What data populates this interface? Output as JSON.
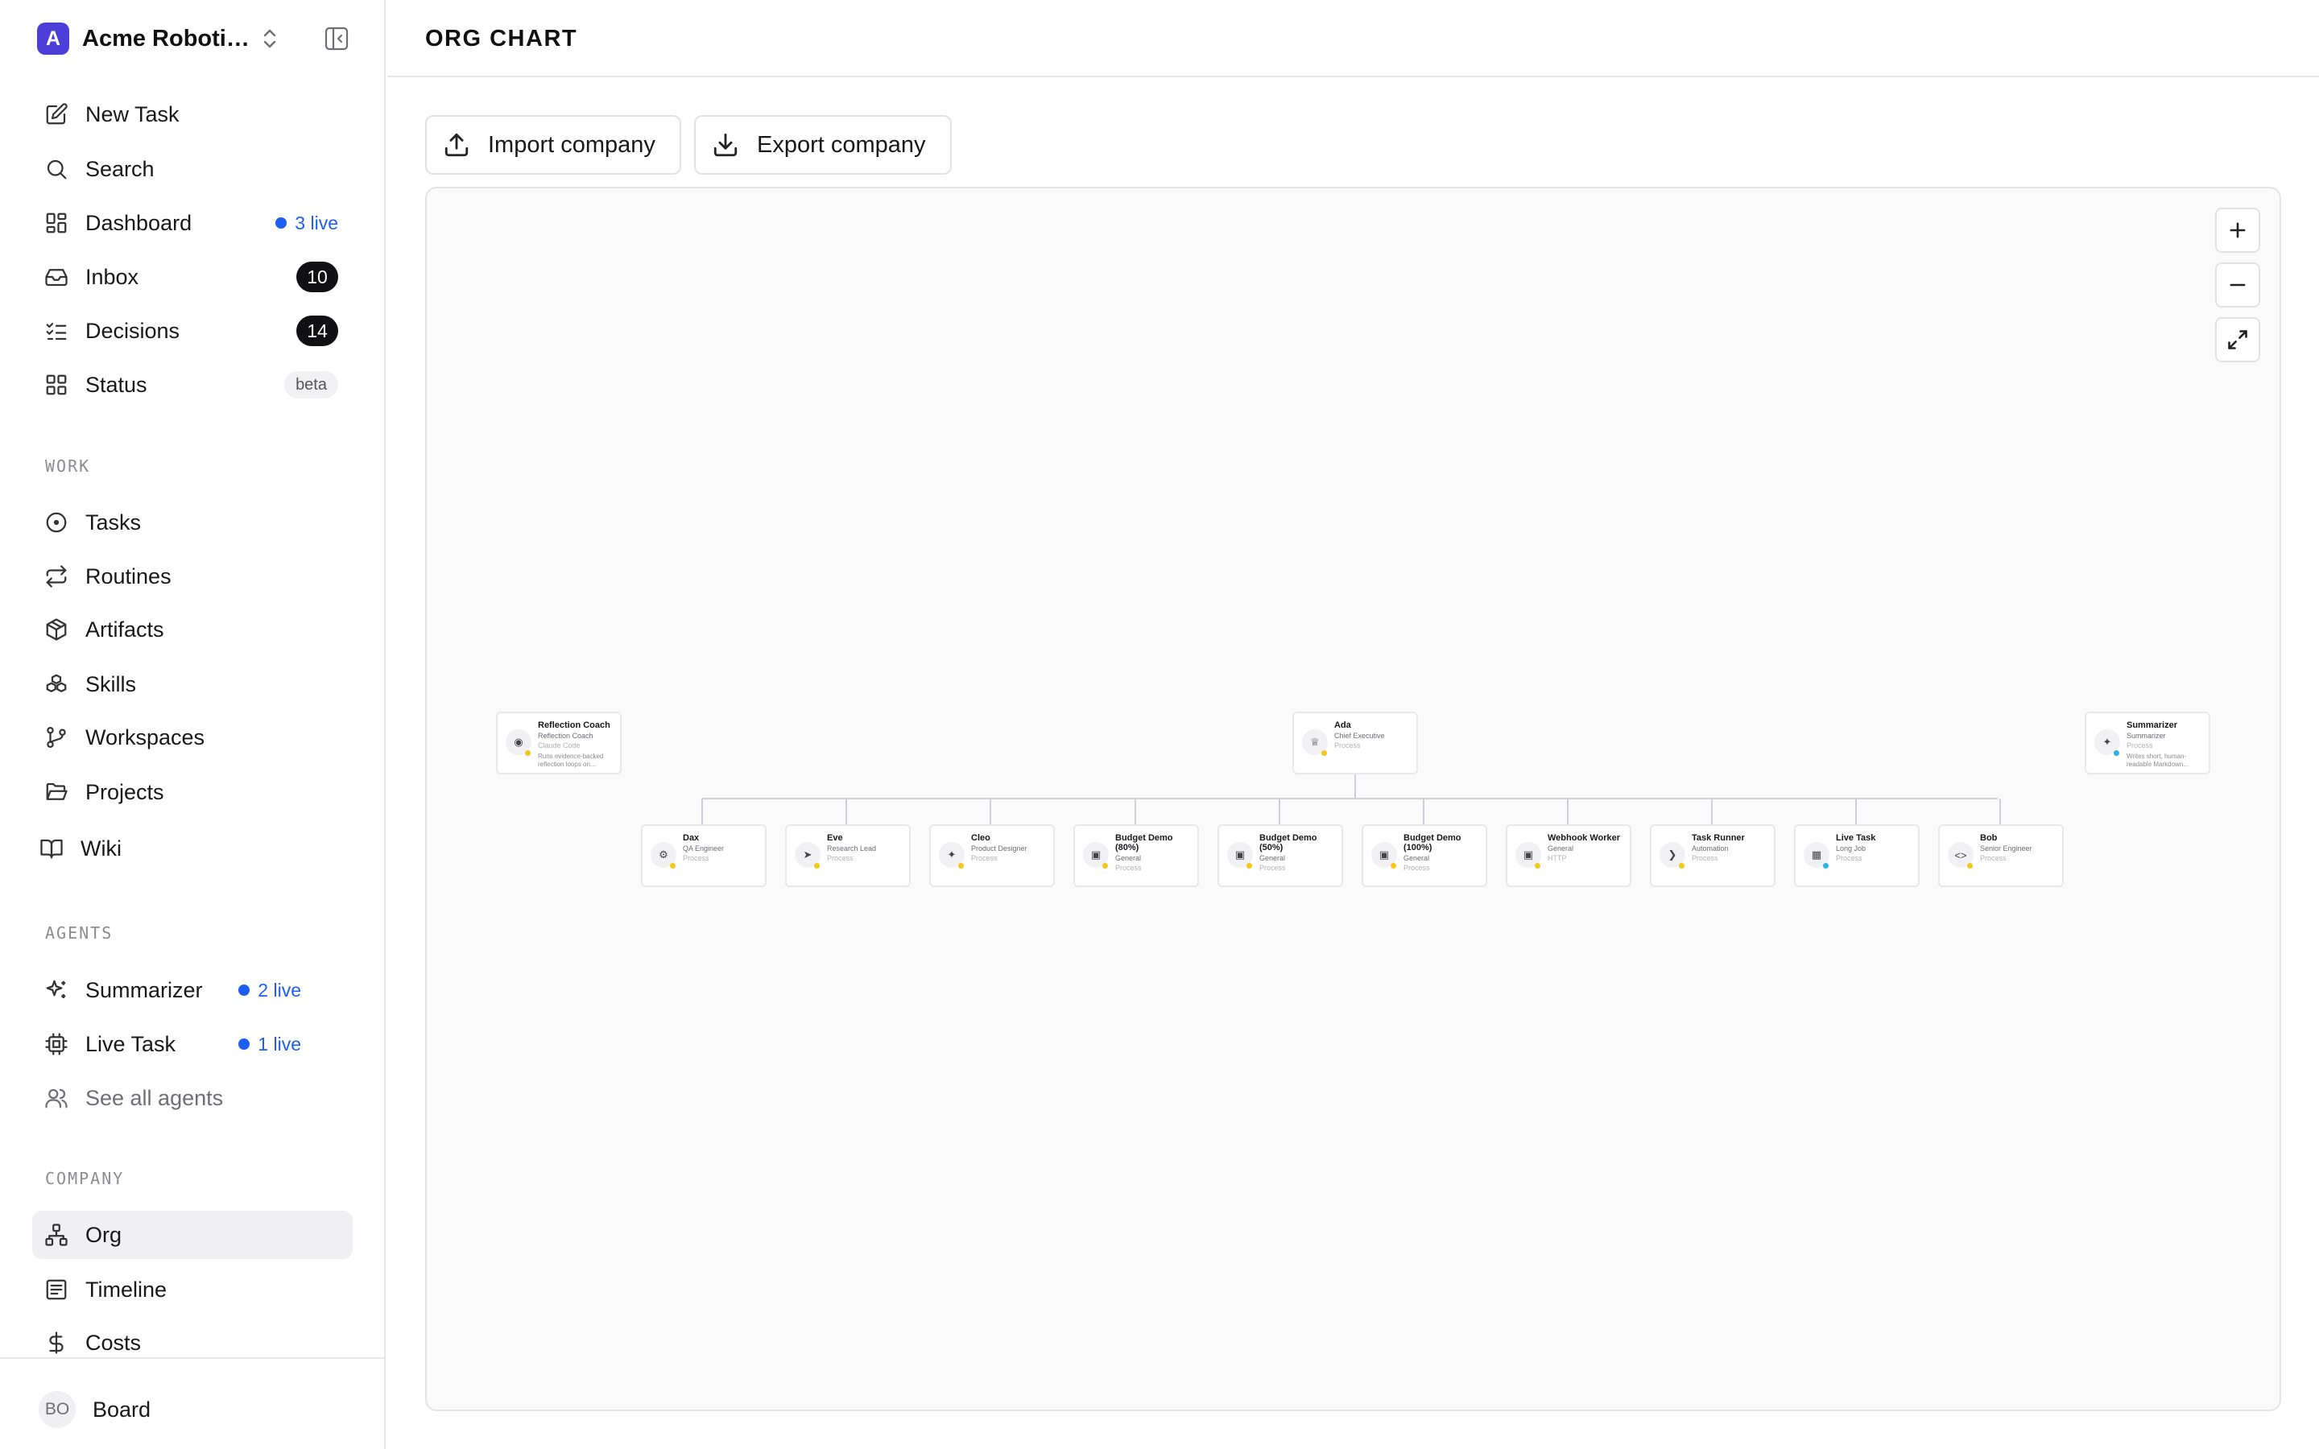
{
  "company": {
    "initial": "A",
    "name": "Acme Robotics"
  },
  "nav": {
    "new_task": "New Task",
    "search": "Search",
    "dashboard": {
      "label": "Dashboard",
      "live": "3 live"
    },
    "inbox": {
      "label": "Inbox",
      "count": "10"
    },
    "decisions": {
      "label": "Decisions",
      "count": "14"
    },
    "status": {
      "label": "Status",
      "badge": "beta"
    }
  },
  "sections": {
    "work": "WORK",
    "agents": "AGENTS",
    "company": "COMPANY"
  },
  "work": {
    "tasks": "Tasks",
    "routines": "Routines",
    "artifacts": "Artifacts",
    "skills": "Skills",
    "workspaces": "Workspaces",
    "projects": "Projects",
    "wiki": "Wiki"
  },
  "agents": {
    "summarizer": {
      "label": "Summarizer",
      "live": "2 live"
    },
    "live_task": {
      "label": "Live Task",
      "live": "1 live"
    },
    "see_all": "See all agents"
  },
  "company_nav": {
    "org": "Org",
    "timeline": "Timeline",
    "costs": "Costs"
  },
  "footer": {
    "initials": "BO",
    "label": "Board"
  },
  "header": {
    "title": "ORG CHART"
  },
  "actions": {
    "import": "Import company",
    "export": "Export company"
  },
  "colors": {
    "accent": "#1d5ef0",
    "status_yellow": "#f5c518",
    "status_blue": "#2bb3e8"
  },
  "org": {
    "reflection": {
      "name": "Reflection Coach",
      "role": "Reflection Coach",
      "adapter": "Claude Code",
      "desc": "Runs evidence-backed reflection loops on...",
      "icon": "eye-icon",
      "status": "yellow"
    },
    "ada": {
      "name": "Ada",
      "role": "Chief Executive",
      "adapter": "Process",
      "icon": "crown-icon",
      "status": "yellow"
    },
    "summarizer": {
      "name": "Summarizer",
      "role": "Summarizer",
      "adapter": "Process",
      "desc": "Writes short, human-readable Markdown...",
      "icon": "sparkles-icon",
      "status": "blue"
    },
    "reports": [
      {
        "name": "Dax",
        "role": "QA Engineer",
        "adapter": "Process",
        "icon": "bug-icon",
        "status": "yellow"
      },
      {
        "name": "Eve",
        "role": "Research Lead",
        "adapter": "Process",
        "icon": "rocket-icon",
        "status": "yellow"
      },
      {
        "name": "Cleo",
        "role": "Product Designer",
        "adapter": "Process",
        "icon": "sparkles-icon",
        "status": "yellow"
      },
      {
        "name": "Budget Demo (80%)",
        "role": "General",
        "adapter": "Process",
        "icon": "bot-icon",
        "status": "yellow"
      },
      {
        "name": "Budget Demo (50%)",
        "role": "General",
        "adapter": "Process",
        "icon": "bot-icon",
        "status": "yellow"
      },
      {
        "name": "Budget Demo (100%)",
        "role": "General",
        "adapter": "Process",
        "icon": "bot-icon",
        "status": "yellow"
      },
      {
        "name": "Webhook Worker",
        "role": "General",
        "adapter": "HTTP",
        "icon": "bot-icon",
        "status": "yellow"
      },
      {
        "name": "Task Runner",
        "role": "Automation",
        "adapter": "Process",
        "icon": "terminal-icon",
        "status": "yellow"
      },
      {
        "name": "Live Task",
        "role": "Long Job",
        "adapter": "Process",
        "icon": "cpu-icon",
        "status": "blue"
      },
      {
        "name": "Bob",
        "role": "Senior Engineer",
        "adapter": "Process",
        "icon": "code-icon",
        "status": "yellow"
      }
    ]
  }
}
